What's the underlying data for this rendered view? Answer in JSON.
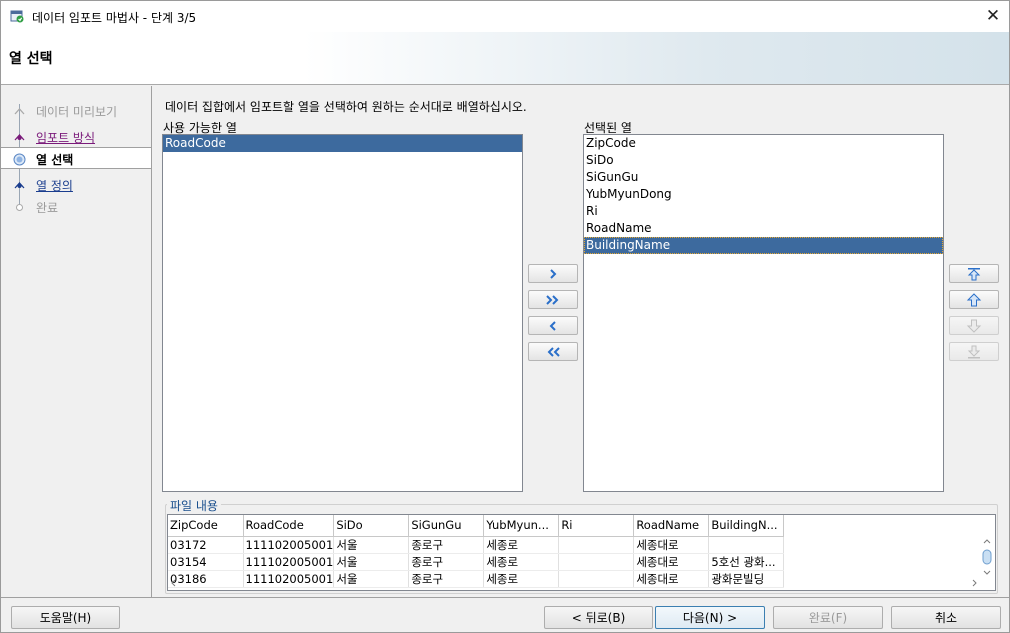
{
  "window": {
    "title": "데이터 임포트 마법사 - 단계 3/5",
    "close_glyph": "✕"
  },
  "header": {
    "title": "열 선택"
  },
  "nav": {
    "items": [
      {
        "label": "데이터 미리보기",
        "state": "done"
      },
      {
        "label": "임포트 방식",
        "state": "visited"
      },
      {
        "label": "열 선택",
        "state": "current"
      },
      {
        "label": "열 정의",
        "state": "link"
      },
      {
        "label": "완료",
        "state": "pending"
      }
    ]
  },
  "main": {
    "instruction": "데이터 집합에서 임포트할 열을 선택하여 원하는 순서대로 배열하십시오.",
    "available": {
      "label": "사용 가능한 열",
      "items": [
        "RoadCode"
      ],
      "selected_index": 0
    },
    "selected": {
      "label": "선택된 열",
      "items": [
        "ZipCode",
        "SiDo",
        "SiGunGu",
        "YubMyunDong",
        "Ri",
        "RoadName",
        "BuildingName"
      ],
      "selected_index": 6
    },
    "transfer_buttons": [
      {
        "icon": "move-right-icon"
      },
      {
        "icon": "move-all-right-icon"
      },
      {
        "icon": "move-left-icon"
      },
      {
        "icon": "move-all-left-icon"
      }
    ],
    "order_buttons": [
      {
        "icon": "move-top-icon",
        "enabled": true
      },
      {
        "icon": "move-up-icon",
        "enabled": true
      },
      {
        "icon": "move-down-icon",
        "enabled": false
      },
      {
        "icon": "move-bottom-icon",
        "enabled": false
      }
    ]
  },
  "file_contents": {
    "label": "파일 내용",
    "columns": [
      "ZipCode",
      "RoadCode",
      "SiDo",
      "SiGunGu",
      "YubMyun...",
      "Ri",
      "RoadName",
      "BuildingN..."
    ],
    "rows": [
      [
        "03172",
        "111102005001",
        "서울",
        "종로구",
        "세종로",
        "",
        "세종대로",
        ""
      ],
      [
        "03154",
        "111102005001",
        "서울",
        "종로구",
        "세종로",
        "",
        "세종대로",
        "5호선 광화..."
      ],
      [
        "03186",
        "111102005001",
        "서울",
        "종로구",
        "세종로",
        "",
        "세종대로",
        "광화문빌딩"
      ]
    ]
  },
  "footer": {
    "help": "도움말(H)",
    "back": "< 뒤로(B)",
    "next": "다음(N) >",
    "finish": "완료(F)",
    "cancel": "취소"
  },
  "colors": {
    "selection": "#3d6a9e",
    "link": "#1a3d8e",
    "visited_link": "#7a1a7a",
    "arrow_blue": "#2a6fc9"
  }
}
